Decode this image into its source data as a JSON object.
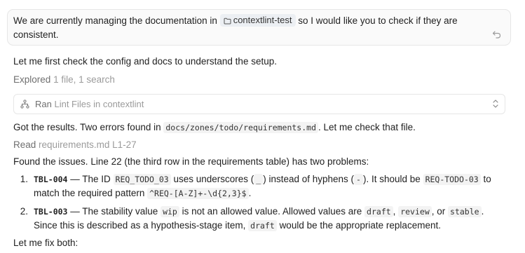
{
  "user_message": {
    "text_before": "We are currently managing the documentation in",
    "chip_label": "contextlint-test",
    "text_after": "so I would like you to check if they are consistent."
  },
  "assistant": {
    "intro": "Let me first check the config and docs to understand the setup.",
    "explored_label": "Explored",
    "explored_detail": "1 file, 1 search",
    "ran_label": "Ran",
    "ran_detail": "Lint Files in contextlint",
    "results_before": "Got the results. Two errors found in",
    "results_code": "docs/zones/todo/requirements.md",
    "results_after": ". Let me check that file.",
    "read_label": "Read",
    "read_detail": "requirements.md L1-27",
    "issues_intro": "Found the issues. Line 22 (the third row in the requirements table) has two problems:",
    "items": [
      {
        "num": "1.",
        "code_id": "TBL-004",
        "t1": "— The ID",
        "c1": "REQ_TODO_03",
        "t2": "uses underscores (",
        "c2": "_",
        "t3": ") instead of hyphens (",
        "c3": "-",
        "t4": "). It should be",
        "c4": "REQ-TODO-03",
        "t5": "to",
        "t6": "match the required pattern",
        "c5": "^REQ-[A-Z]+-\\d{2,3}$",
        "t7": "."
      },
      {
        "num": "2.",
        "code_id": "TBL-003",
        "t1": "— The stability value",
        "c1": "wip",
        "t2": "is not an allowed value. Allowed values are",
        "c2": "draft",
        "t3": ",",
        "c3": "review",
        "t4": ", or",
        "c4": "stable",
        "t5": ".",
        "t6": "Since this is described as a hypothesis-stage item,",
        "c5": "draft",
        "t7": "would be the appropriate replacement."
      }
    ],
    "closing": "Let me fix both:"
  }
}
